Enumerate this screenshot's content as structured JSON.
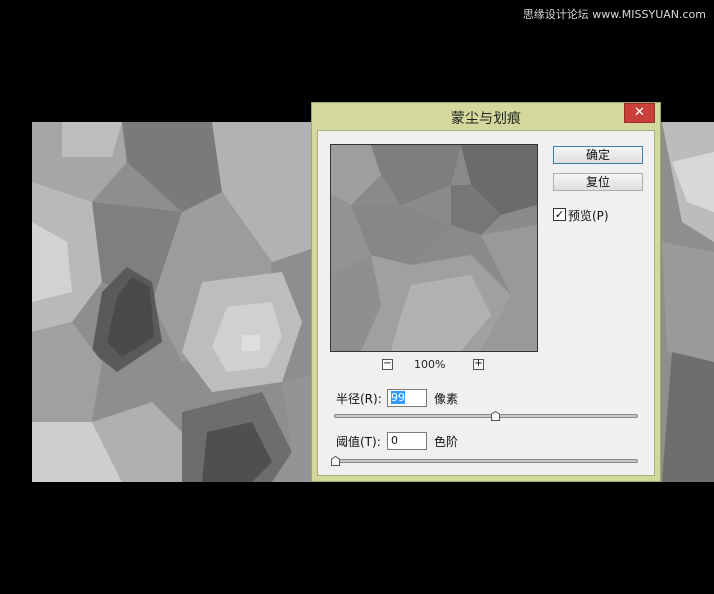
{
  "watermark": "思缘设计论坛 www.MISSYUAN.com",
  "dialog": {
    "title": "蒙尘与划痕",
    "close_glyph": "✕",
    "ok_label": "确定",
    "reset_label": "复位",
    "preview_label": "预览(P)",
    "preview_checked": true,
    "zoom_out_glyph": "−",
    "zoom_in_glyph": "+",
    "zoom_value": "100%",
    "radius": {
      "label": "半径(R):",
      "value": "99",
      "unit": "像素",
      "slider_fraction": 0.53
    },
    "threshold": {
      "label": "阈值(T):",
      "value": "0",
      "unit": "色阶",
      "slider_fraction": 0.0
    }
  },
  "colors": {
    "titlebar": "#d3d99c",
    "close": "#c9403a",
    "client_bg": "#f0f0f0",
    "selection": "#3399ff"
  }
}
